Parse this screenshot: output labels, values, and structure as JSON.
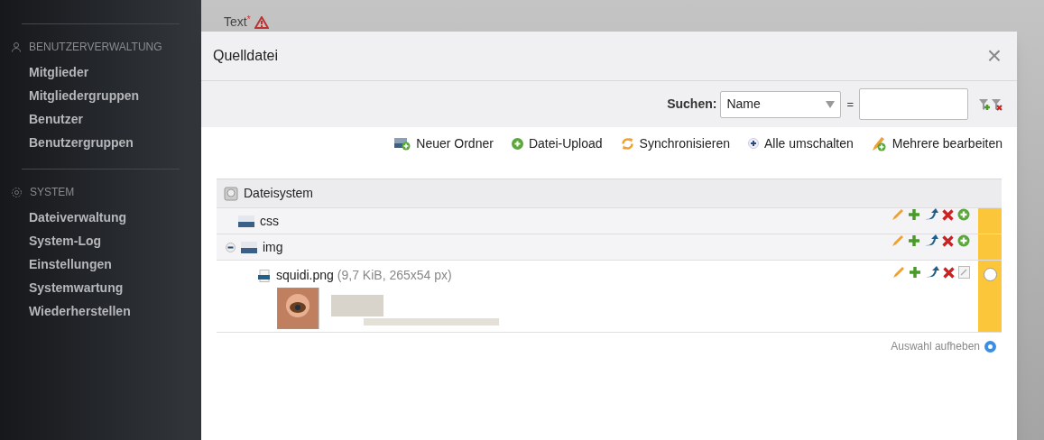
{
  "sidebar": {
    "sections": [
      {
        "title": "BENUTZERVERWALTUNG",
        "items": [
          "Mitglieder",
          "Mitgliedergruppen",
          "Benutzer",
          "Benutzergruppen"
        ]
      },
      {
        "title": "SYSTEM",
        "items": [
          "Dateiverwaltung",
          "System-Log",
          "Einstellungen",
          "Systemwartung",
          "Wiederherstellen"
        ]
      }
    ]
  },
  "background_form": {
    "label": "Text",
    "required_mark": "*"
  },
  "dialog": {
    "title": "Quelldatei",
    "close": "×",
    "search": {
      "label": "Suchen:",
      "field": "Name",
      "equals": "="
    },
    "toolbar": [
      {
        "kind": "folder",
        "label": "Neuer Ordner"
      },
      {
        "kind": "upload",
        "label": "Datei-Upload"
      },
      {
        "kind": "sync",
        "label": "Synchronisieren"
      },
      {
        "kind": "toggle",
        "label": "Alle umschalten"
      },
      {
        "kind": "edit",
        "label": "Mehrere bearbeiten"
      }
    ],
    "tree": {
      "root": "Dateisystem",
      "children": [
        {
          "kind": "folder",
          "name": "css",
          "expanded": false
        },
        {
          "kind": "folder",
          "name": "img",
          "expanded": true,
          "children": [
            {
              "kind": "file",
              "name": "squidi.png",
              "meta": "(9,7 KiB, 265x54 px)",
              "selected": false
            }
          ]
        }
      ]
    },
    "deselect": {
      "label": "Auswahl aufheben",
      "selected": true
    }
  }
}
